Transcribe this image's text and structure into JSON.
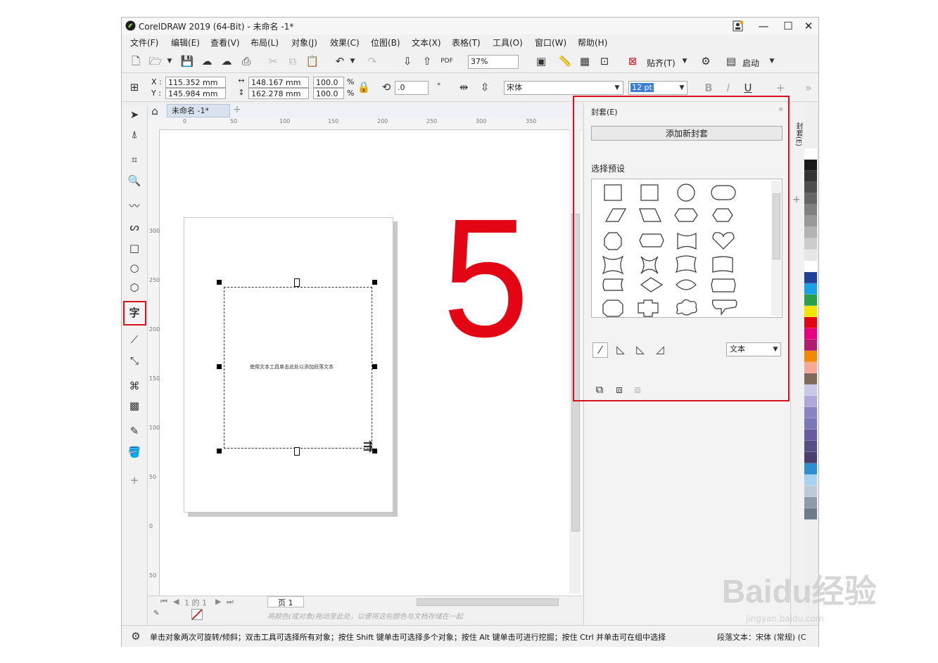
{
  "window": {
    "title": "CorelDRAW 2019 (64-Bit) - 未命名 -1*",
    "controls": {
      "minimize": "—",
      "maximize": "☐",
      "close": "✕"
    }
  },
  "menu": [
    "文件(F)",
    "编辑(E)",
    "查看(V)",
    "布局(L)",
    "对象(J)",
    "效果(C)",
    "位图(B)",
    "文本(X)",
    "表格(T)",
    "工具(O)",
    "窗口(W)",
    "帮助(H)"
  ],
  "standard_toolbar": {
    "zoom": "37%",
    "snap": "贴齐(T)",
    "launch": "启动"
  },
  "property_bar": {
    "x_label": "X :",
    "x_value": "115.352 mm",
    "y_label": "Y :",
    "y_value": "145.984 mm",
    "width": "148.167 mm",
    "height": "162.278 mm",
    "scale_x": "100.0",
    "scale_y": "100.0",
    "pct": "%",
    "angle": ".0",
    "degree": "°",
    "font": "宋体",
    "size": "12 pt"
  },
  "doc_tab": "未命名 -1*",
  "ruler_h": [
    "0",
    "50",
    "100",
    "150",
    "200",
    "250",
    "300",
    "350"
  ],
  "ruler_v": [
    "300",
    "250",
    "200",
    "150",
    "100",
    "50",
    "0",
    "50"
  ],
  "frame_text": "使用文本工具单击此处以添加段落文本",
  "annotation_number": "5",
  "page_nav": {
    "counter": "1 的 1",
    "page": "页 1"
  },
  "color_hint": "将颜色(或对象)拖动至此处，以便将这些颜色与文档存储在一起",
  "status_text": "单击对象两次可旋转/倾斜；双击工具可选择所有对象；按住 Shift 键单击可选择多个对象；按住 Alt 键单击可进行挖掘；按住 Ctrl 并单击可在组中选择",
  "status_right": "段落文本：宋体 (常规) (C",
  "docker": {
    "title": "封套(E)",
    "add_button": "添加新封套",
    "preset_label": "选择预设",
    "mode_value": "文本",
    "side_tab": "封套(E)"
  },
  "palette": [
    "#ffffff",
    "#1a1a1a",
    "#333333",
    "#4d4d4d",
    "#666666",
    "#808080",
    "#999999",
    "#b3b3b3",
    "#cccccc",
    "#e6e6e6",
    "#ffffff",
    "#1f3f99",
    "#1aa0e6",
    "#2aa04a",
    "#f2e600",
    "#e30513",
    "#e6007e",
    "#b01c6e",
    "#f08a00",
    "#f4a999",
    "#7f6a5a",
    "#c8c8e8",
    "#b0a8d8",
    "#8a84c0",
    "#7b78b8",
    "#6a5aa0",
    "#545085",
    "#4a3e6e",
    "#2e8fd0",
    "#a9d2ee",
    "#bcc9d6",
    "#8e9aa8",
    "#6e7b88"
  ],
  "watermark": {
    "brand": "Baidu经验",
    "url": "jingyan.baidu.com"
  }
}
